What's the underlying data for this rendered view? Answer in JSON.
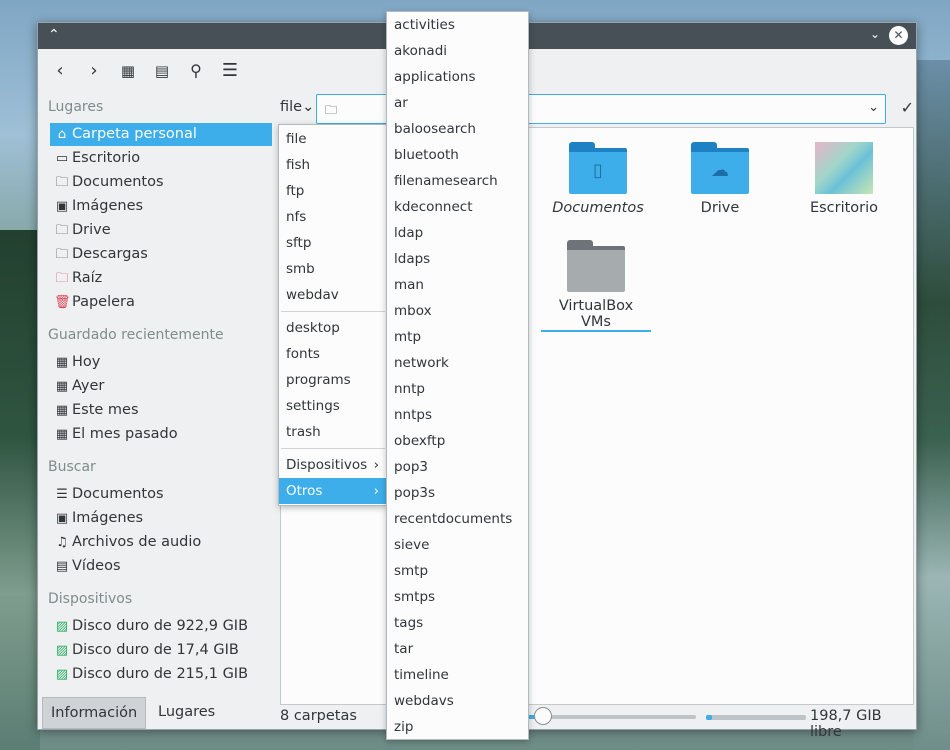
{
  "sidebar": {
    "places_title": "Lugares",
    "places": [
      {
        "label": "Carpeta personal",
        "icon": "home-icon",
        "active": true
      },
      {
        "label": "Escritorio",
        "icon": "desktop-icon"
      },
      {
        "label": "Documentos",
        "icon": "folder-icon"
      },
      {
        "label": "Imágenes",
        "icon": "image-icon"
      },
      {
        "label": "Drive",
        "icon": "folder-icon"
      },
      {
        "label": "Descargas",
        "icon": "folder-icon"
      },
      {
        "label": "Raíz",
        "icon": "root-folder-icon"
      },
      {
        "label": "Papelera",
        "icon": "trash-icon"
      }
    ],
    "recent_title": "Guardado recientemente",
    "recent": [
      {
        "label": "Hoy",
        "icon": "calendar-icon"
      },
      {
        "label": "Ayer",
        "icon": "calendar-icon"
      },
      {
        "label": "Este mes",
        "icon": "calendar-icon"
      },
      {
        "label": "El mes pasado",
        "icon": "calendar-icon"
      }
    ],
    "search_title": "Buscar",
    "search": [
      {
        "label": "Documentos",
        "icon": "document-icon"
      },
      {
        "label": "Imágenes",
        "icon": "image-icon"
      },
      {
        "label": "Archivos de audio",
        "icon": "music-icon"
      },
      {
        "label": "Vídeos",
        "icon": "video-icon"
      }
    ],
    "devices_title": "Dispositivos",
    "devices": [
      {
        "label": "Disco duro de 922,9 GIB",
        "icon": "harddisk-icon"
      },
      {
        "label": "Disco duro de 17,4 GIB",
        "icon": "harddisk-icon"
      },
      {
        "label": "Disco duro de 215,1 GIB",
        "icon": "harddisk-icon"
      }
    ]
  },
  "bottom_tabs": [
    "Información",
    "Lugares"
  ],
  "urlbar": {
    "protocol": "file",
    "path": ""
  },
  "files": [
    {
      "name": "Documentos",
      "type": "folder-documents"
    },
    {
      "name": "Drive",
      "type": "folder-cloud"
    },
    {
      "name": "Escritorio",
      "type": "desktop-thumbnail"
    },
    {
      "name": "VirtualBox VMs",
      "type": "folder-gray"
    }
  ],
  "status": {
    "count": "8 carpetas",
    "free": "198,7 GIB libre",
    "zoom_level": 0.08,
    "used_fraction": 0.06
  },
  "protocol_menu": {
    "group1": [
      "file",
      "fish",
      "ftp",
      "nfs",
      "sftp",
      "smb",
      "webdav"
    ],
    "group2": [
      "desktop",
      "fonts",
      "programs",
      "settings",
      "trash"
    ],
    "group3": [
      "Dispositivos",
      "Otros"
    ]
  },
  "others_menu": [
    "activities",
    "akonadi",
    "applications",
    "ar",
    "baloosearch",
    "bluetooth",
    "filenamesearch",
    "kdeconnect",
    "ldap",
    "ldaps",
    "man",
    "mbox",
    "mtp",
    "network",
    "nntp",
    "nntps",
    "obexftp",
    "pop3",
    "pop3s",
    "recentdocuments",
    "sieve",
    "smtp",
    "smtps",
    "tags",
    "tar",
    "timeline",
    "webdavs",
    "zip"
  ],
  "colors": {
    "accent": "#3daee9",
    "titlebar": "#475057"
  }
}
